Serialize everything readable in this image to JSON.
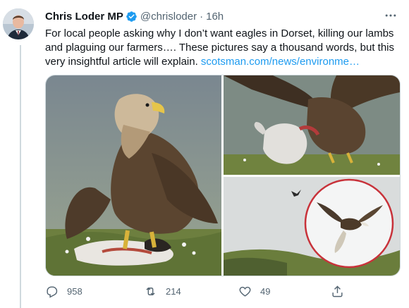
{
  "tweet": {
    "author_name": "Chris Loder MP",
    "handle": "@chrisloder",
    "separator": "·",
    "time": "16h",
    "text": "For local people asking why I don’t want eagles in Dorset, killing our lambs and plaguing our farmers…. These pictures say a thousand words, but this very insightful article will explain. ",
    "link_text": "scotsman.com/news/environme…",
    "reply_count": "958",
    "retweet_count": "214",
    "like_count": "49"
  },
  "icons": {
    "verified": "verified-badge-icon",
    "more": "more-horizontal-icon",
    "reply": "reply-icon",
    "retweet": "retweet-icon",
    "like": "heart-icon",
    "share": "share-icon"
  },
  "colors": {
    "link": "#1d9bf0",
    "verified": "#1d9bf0",
    "secondary_text": "#536471",
    "thread_line": "#cfd9de"
  }
}
